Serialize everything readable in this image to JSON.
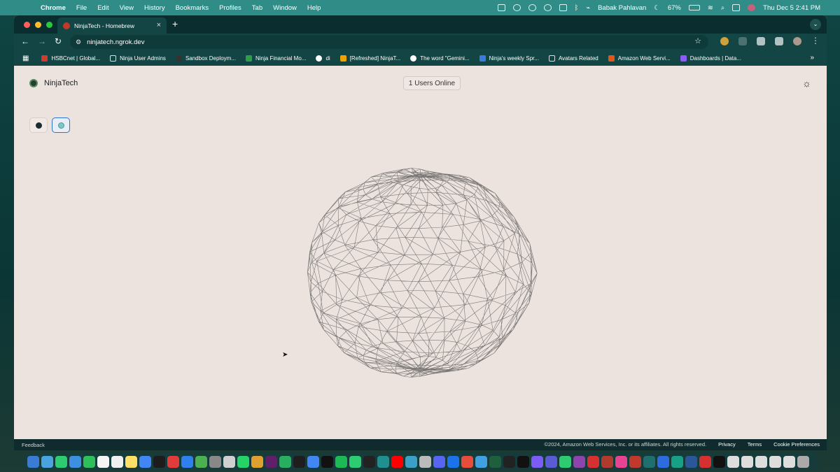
{
  "menubar": {
    "app": "Chrome",
    "items": [
      "File",
      "Edit",
      "View",
      "History",
      "Bookmarks",
      "Profiles",
      "Tab",
      "Window",
      "Help"
    ],
    "user": "Babak Pahlavan",
    "battery": "67%",
    "datetime": "Thu Dec 5  2:41 PM"
  },
  "tab": {
    "title": "NinjaTech - Homebrew"
  },
  "address": {
    "url": "ninjatech.ngrok.dev"
  },
  "bookmarks": [
    {
      "label": "HSBCnet | Global...",
      "color": "#d13b2e",
      "folder": false
    },
    {
      "label": "Ninja User Admins",
      "color": "",
      "folder": true
    },
    {
      "label": "Sandbox Deploym...",
      "color": "#333333",
      "folder": false
    },
    {
      "label": "Ninja Financial Mo...",
      "color": "#2e9e4a",
      "folder": false
    },
    {
      "label": "di",
      "color": "#ffffff",
      "folder": false
    },
    {
      "label": "[Refreshed] NinjaT...",
      "color": "#f0a300",
      "folder": false
    },
    {
      "label": "The word \"Gemini...",
      "color": "#ffffff",
      "folder": false
    },
    {
      "label": "Ninja's weekly Spr...",
      "color": "#3b7be0",
      "folder": false
    },
    {
      "label": "Avatars Related",
      "color": "",
      "folder": true
    },
    {
      "label": "Amazon Web Servi...",
      "color": "#e0561b",
      "folder": false
    },
    {
      "label": "Dashboards | Data...",
      "color": "#8b5cf6",
      "folder": false
    }
  ],
  "page": {
    "brand": "NinjaTech",
    "users_online": "1 Users Online"
  },
  "footer": {
    "feedback": "Feedback",
    "copyright": "©2024, Amazon Web Services, Inc. or its affiliates. All rights reserved.",
    "privacy": "Privacy",
    "terms": "Terms",
    "cookies": "Cookie Preferences"
  },
  "colors": {
    "accent": "#2d73c9",
    "page_bg": "#ece3df"
  }
}
